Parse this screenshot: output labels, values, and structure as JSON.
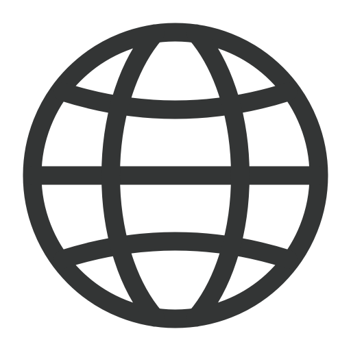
{
  "icon": {
    "name": "globe-icon",
    "stroke_color": "#333535",
    "background_color": "#ffffff"
  }
}
